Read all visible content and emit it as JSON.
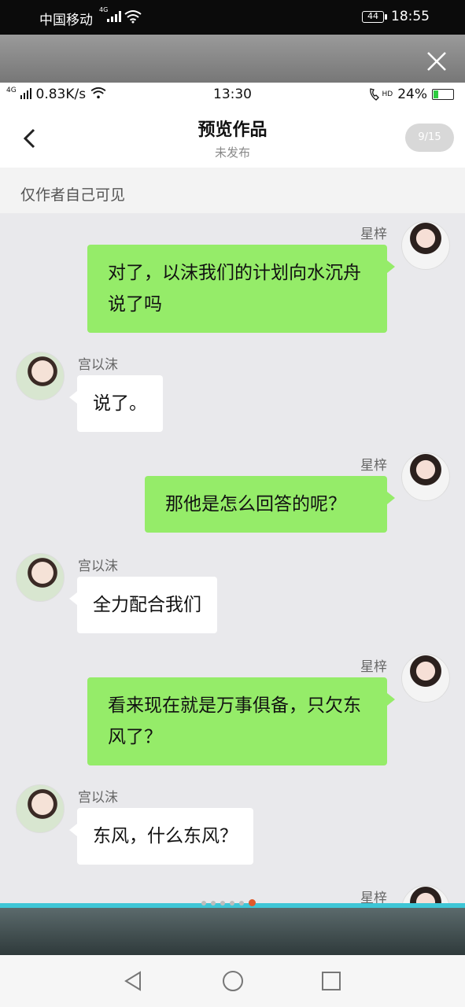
{
  "outer_status": {
    "carrier": "中国移动",
    "network_mini": "4G",
    "battery": "44",
    "time": "18:55"
  },
  "viewer": {
    "close_icon": "close-icon",
    "page_indicator": {
      "total_dots": 6,
      "active_index": 5
    }
  },
  "inner_status": {
    "network": "4G",
    "speed": "0.83K/s",
    "time": "13:30",
    "hd_label": "HD",
    "battery": "24%"
  },
  "header": {
    "title": "预览作品",
    "subtitle": "未发布",
    "page_counter": "9/15"
  },
  "notice": "仅作者自己可见",
  "messages": [
    {
      "side": "me",
      "name": "星梓",
      "text": "对了，以沫我们的计划向水沉舟说了吗"
    },
    {
      "side": "them",
      "name": "宫以沫",
      "text": "说了。"
    },
    {
      "side": "me",
      "name": "星梓",
      "text": "那他是怎么回答的呢？"
    },
    {
      "side": "them",
      "name": "宫以沫",
      "text": "全力配合我们"
    },
    {
      "side": "me",
      "name": "星梓",
      "text": "看来现在就是万事俱备，只欠东风了？"
    },
    {
      "side": "them",
      "name": "宫以沫",
      "text": "东风，什么东风？"
    },
    {
      "side": "me",
      "name": "星梓",
      "text": ""
    }
  ],
  "colors": {
    "my_bubble": "#95ec69",
    "their_bubble": "#ffffff",
    "chat_background": "#e9e9ec",
    "active_dot": "#e05a2b",
    "accent_line": "#3ec6d6"
  }
}
